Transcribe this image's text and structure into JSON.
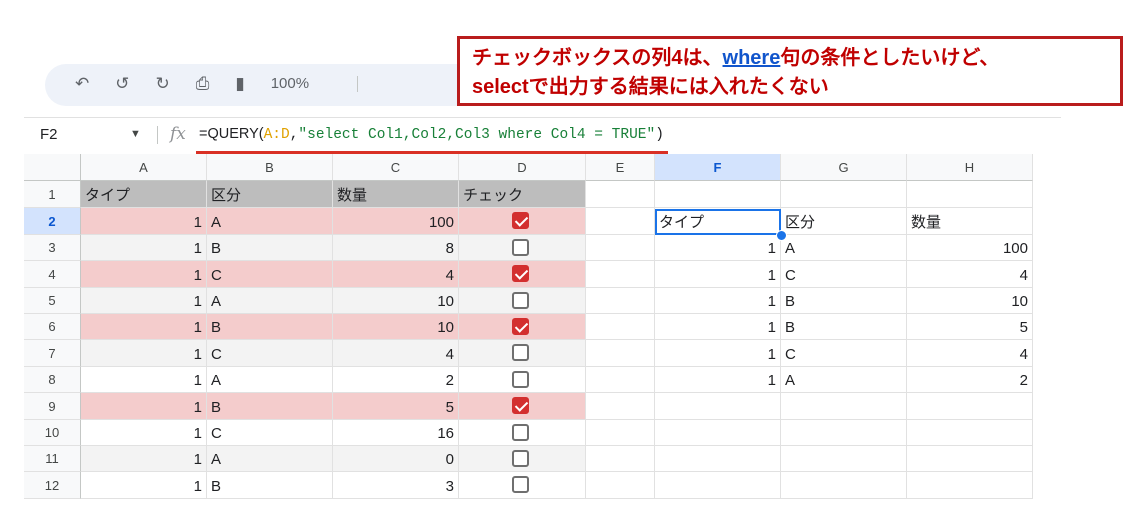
{
  "toolbar": {
    "icons": [
      "back-icon",
      "undo-icon",
      "redo-icon",
      "print-icon",
      "paint-format-icon"
    ],
    "zoom": "100%"
  },
  "callout": {
    "line1_prefix": "チェックボックスの列4は、",
    "line1_highlight": "where",
    "line1_suffix": "句の条件としたいけど、",
    "line2": "selectで出力する結果には入れたくない",
    "colors": {
      "border": "#b91c1c",
      "text": "#c00000",
      "highlight": "#1155cc"
    }
  },
  "formula_bar": {
    "name_box": "F2",
    "fx_label": "fx",
    "formula_prefix": "=QUERY(",
    "formula_range": "A:D",
    "formula_sep": ",",
    "formula_string": "\"select Col1,Col2,Col3 where Col4 = TRUE\"",
    "formula_suffix": ")"
  },
  "columns": [
    "A",
    "B",
    "C",
    "D",
    "E",
    "F",
    "G",
    "H"
  ],
  "selected_column": "F",
  "rows": [
    "1",
    "2",
    "3",
    "4",
    "5",
    "6",
    "7",
    "8",
    "9",
    "10",
    "11",
    "12"
  ],
  "selected_row": "2",
  "source_header": [
    "タイプ",
    "区分",
    "数量",
    "チェック"
  ],
  "source_data": [
    {
      "type": "1",
      "category": "A",
      "qty": "100",
      "check": true
    },
    {
      "type": "1",
      "category": "B",
      "qty": "8",
      "check": false
    },
    {
      "type": "1",
      "category": "C",
      "qty": "4",
      "check": true
    },
    {
      "type": "1",
      "category": "A",
      "qty": "10",
      "check": false
    },
    {
      "type": "1",
      "category": "B",
      "qty": "10",
      "check": true
    },
    {
      "type": "1",
      "category": "C",
      "qty": "4",
      "check": false
    },
    {
      "type": "1",
      "category": "A",
      "qty": "2",
      "check": false
    },
    {
      "type": "1",
      "category": "B",
      "qty": "5",
      "check": true
    },
    {
      "type": "1",
      "category": "C",
      "qty": "16",
      "check": false
    },
    {
      "type": "1",
      "category": "A",
      "qty": "0",
      "check": false
    },
    {
      "type": "1",
      "category": "B",
      "qty": "3",
      "check": false
    }
  ],
  "result_header": [
    "タイプ",
    "区分",
    "数量"
  ],
  "result_data": [
    {
      "type": "1",
      "category": "A",
      "qty": "100"
    },
    {
      "type": "1",
      "category": "C",
      "qty": "4"
    },
    {
      "type": "1",
      "category": "B",
      "qty": "10"
    },
    {
      "type": "1",
      "category": "B",
      "qty": "5"
    },
    {
      "type": "1",
      "category": "C",
      "qty": "4"
    },
    {
      "type": "1",
      "category": "A",
      "qty": "2"
    }
  ],
  "colors": {
    "header_fill": "#bdbdbd",
    "checked_row_fill": "#f4cccc",
    "alt_row_fill": "#f3f3f3",
    "checkbox_on": "#d32f2f",
    "selection": "#1a73e8",
    "annotation_underline": "#d93025"
  }
}
